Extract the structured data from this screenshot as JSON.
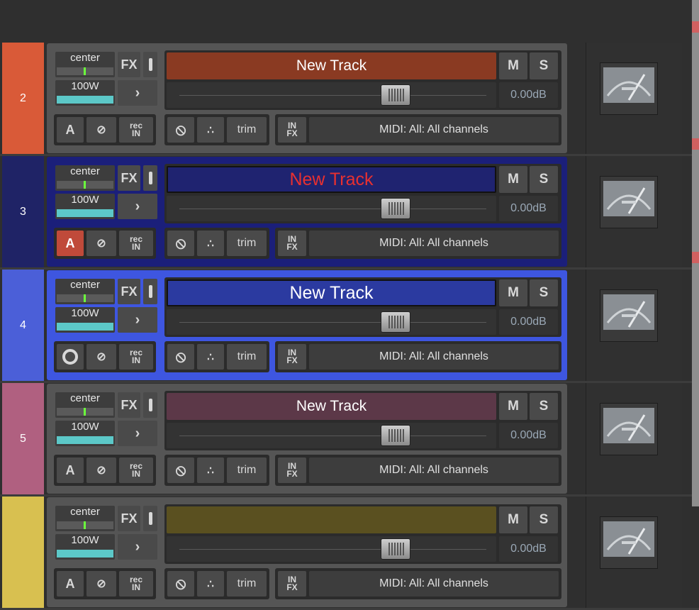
{
  "tracks": [
    {
      "number": "",
      "name": "",
      "color": "#2d5a2b",
      "namebg": "",
      "namecolor": "#fff",
      "selected": false,
      "partial": "top",
      "a_active": false,
      "a_icon": "A"
    },
    {
      "number": "2",
      "name": "New Track",
      "color": "#d95a38",
      "namebg": "#8a3a22",
      "namecolor": "#ffffff",
      "selected": false,
      "partial": "",
      "a_active": false,
      "a_icon": "A"
    },
    {
      "number": "3",
      "name": "New Track",
      "color": "#1f2366",
      "namebg": "#1f2370",
      "namecolor": "#e83030",
      "selected": true,
      "seltone": "#1b1f7a",
      "partial": "",
      "a_active": true,
      "a_icon": "A"
    },
    {
      "number": "4",
      "name": "New Track",
      "color": "#4b5fd8",
      "namebg": "#2b3aa0",
      "namecolor": "#ffffff",
      "selected": true,
      "seltone": "#3e56e0",
      "partial": "",
      "a_active": false,
      "a_icon": "circle"
    },
    {
      "number": "5",
      "name": "New Track",
      "color": "#b06080",
      "namebg": "#5c3848",
      "namecolor": "#ffffff",
      "selected": false,
      "partial": "",
      "a_active": false,
      "a_icon": "A"
    },
    {
      "number": "",
      "name": "",
      "color": "#d8c050",
      "namebg": "#5a5020",
      "namecolor": "#fff",
      "selected": false,
      "partial": "bottom",
      "a_active": false,
      "a_icon": "A"
    }
  ],
  "labels": {
    "pan": "center",
    "width": "100W",
    "fx": "FX",
    "mute": "M",
    "solo": "S",
    "volume": "0.00dB",
    "rec_top": "rec",
    "rec_bottom": "IN",
    "trim": "trim",
    "infx_top": "IN",
    "infx_bottom": "FX",
    "midi": "MIDI: All: All channels",
    "auto": "A"
  }
}
